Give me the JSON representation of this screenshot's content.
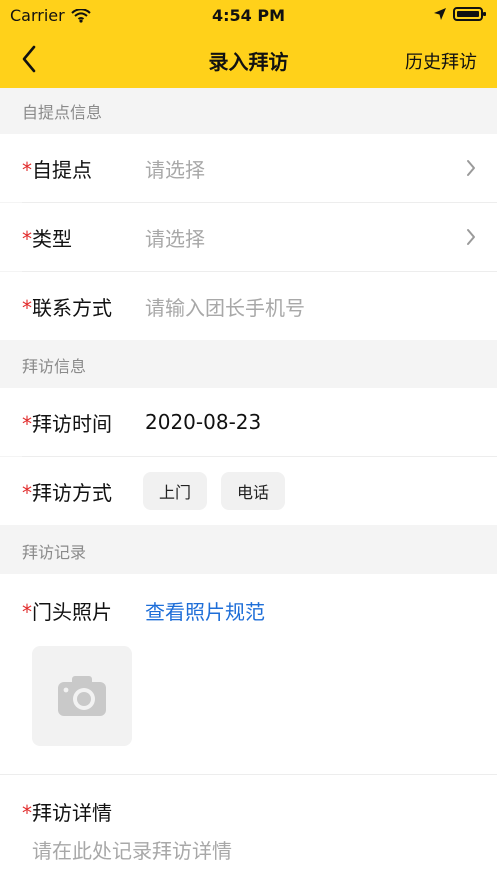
{
  "status_bar": {
    "carrier": "Carrier",
    "time": "4:54 PM"
  },
  "nav": {
    "title": "录入拜访",
    "right_action": "历史拜访"
  },
  "sections": {
    "pickup_info": "自提点信息",
    "visit_info": "拜访信息",
    "visit_record": "拜访记录"
  },
  "fields": {
    "pickup": {
      "required": "*",
      "label": "自提点",
      "placeholder": "请选择"
    },
    "type": {
      "required": "*",
      "label": "类型",
      "placeholder": "请选择"
    },
    "contact": {
      "required": "*",
      "label": "联系方式",
      "placeholder": "请输入团长手机号"
    },
    "visit_time": {
      "required": "*",
      "label": "拜访时间",
      "value": "2020-08-23"
    },
    "visit_method": {
      "required": "*",
      "label": "拜访方式",
      "options": [
        "上门",
        "电话"
      ]
    },
    "door_photo": {
      "required": "*",
      "label": "门头照片",
      "link": "查看照片规范"
    },
    "visit_detail": {
      "required": "*",
      "label": "拜访详情",
      "placeholder": "请在此处记录拜访详情"
    }
  },
  "colors": {
    "header_bg": "#FFD11A",
    "required": "#e12b2b",
    "link": "#1e6ed8"
  },
  "icons": {
    "wifi": "wifi-icon",
    "location": "location-arrow-icon",
    "battery": "battery-icon",
    "back": "chevron-left-icon",
    "right_chevron": "chevron-right-icon",
    "camera": "camera-icon"
  }
}
